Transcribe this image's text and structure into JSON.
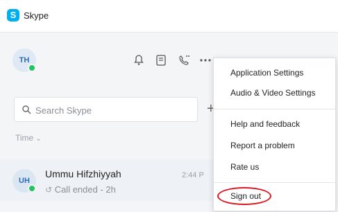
{
  "app": {
    "title": "Skype"
  },
  "profile": {
    "initials": "TH"
  },
  "search": {
    "placeholder": "Search Skype"
  },
  "filter": {
    "label": "Time"
  },
  "conversation": {
    "initials": "UH",
    "name": "Ummu Hifzhiyyah",
    "time": "2:44 P",
    "status": "Call ended - 2h"
  },
  "menu": {
    "items": [
      "Application Settings",
      "Audio & Video Settings",
      "Help and feedback",
      "Report a problem",
      "Rate us",
      "Sign out"
    ]
  },
  "colors": {
    "brand": "#00aff0",
    "online": "#21c460",
    "highlight": "#d9191f"
  },
  "icons": [
    "skype-logo",
    "bell-icon",
    "contacts-icon",
    "dial-pad-icon",
    "more-icon",
    "search-icon",
    "plus-icon",
    "call-icon"
  ]
}
